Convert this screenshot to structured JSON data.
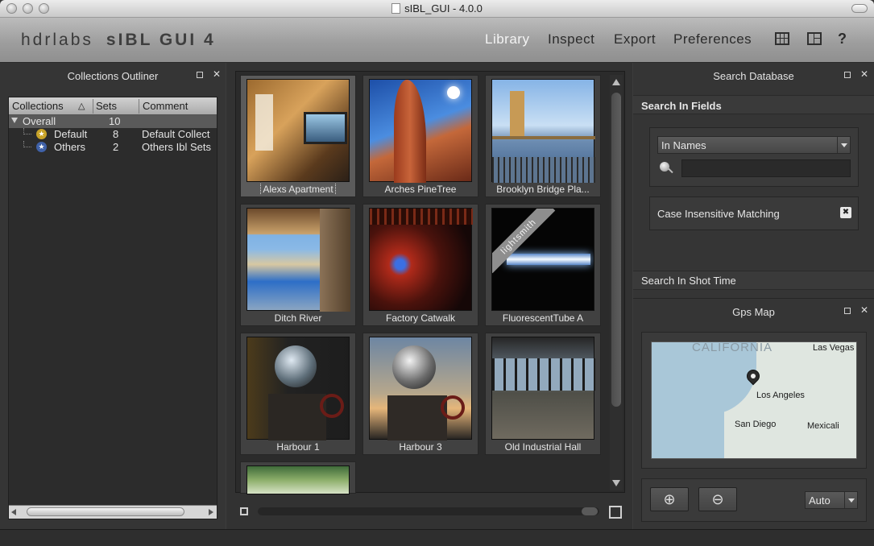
{
  "window": {
    "title": "sIBL_GUI - 4.0.0"
  },
  "toolbar": {
    "brand_left": "hdrlabs",
    "brand_right": "sIBL GUI 4",
    "nav": [
      "Library",
      "Inspect",
      "Export",
      "Preferences"
    ],
    "active": "Library",
    "help_label": "?"
  },
  "collections": {
    "title": "Collections Outliner",
    "columns": [
      "Collections",
      "Sets",
      "Comment"
    ],
    "sort_indicator": "△",
    "rows": [
      {
        "name": "Overall",
        "sets": "10",
        "comment": ""
      },
      {
        "name": "Default",
        "sets": "8",
        "comment": "Default Collect"
      },
      {
        "name": "Others",
        "sets": "2",
        "comment": "Others Ibl Sets"
      }
    ]
  },
  "library": {
    "items": [
      {
        "label": "Alexs Apartment",
        "selected": true
      },
      {
        "label": "Arches PineTree"
      },
      {
        "label": "Brooklyn Bridge Pla..."
      },
      {
        "label": "Ditch River"
      },
      {
        "label": "Factory Catwalk"
      },
      {
        "label": "FluorescentTube A",
        "badge": "lightsmith"
      },
      {
        "label": "Harbour 1"
      },
      {
        "label": "Harbour 3"
      },
      {
        "label": "Old Industrial Hall"
      },
      {
        "label": ""
      }
    ]
  },
  "search": {
    "title": "Search Database",
    "fields_section": "Search In Fields",
    "combo_value": "In Names",
    "input_value": "",
    "case_label": "Case Insensitive Matching",
    "case_mark": "✖",
    "shot_time_section": "Search In Shot Time"
  },
  "gps": {
    "title": "Gps Map",
    "region_label": "CALIFORNIA",
    "cities": [
      "Las Vegas",
      "Los Angeles",
      "San Diego",
      "Mexicali"
    ],
    "zoom_in": "⊕",
    "zoom_out": "⊖",
    "map_type": "Auto"
  },
  "colors": {
    "accent": "#f4f4f4",
    "panel": "#353535",
    "toolbar": "#a8a8a8"
  }
}
